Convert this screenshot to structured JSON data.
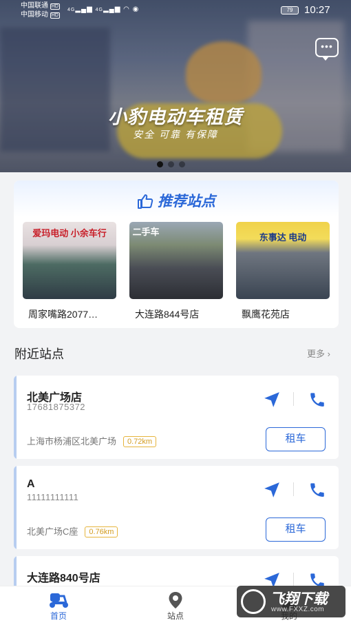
{
  "status_bar": {
    "carrier1": "中国联通",
    "carrier1_badge": "HD",
    "carrier2": "中国移动",
    "carrier2_badge": "HD",
    "network": "4G",
    "battery": "79",
    "time": "10:27"
  },
  "banner": {
    "title": "小豹电动车租赁",
    "subtitle": "安全 可靠 有保障",
    "slide_count": 3,
    "active_slide": 1,
    "chat_icon": "chat-bubble-icon"
  },
  "recommended": {
    "title": "推荐站点",
    "icon": "thumbs-up-icon",
    "stores": [
      {
        "name": "周家嘴路2077…",
        "sign_text": "爱玛电动 小余车行"
      },
      {
        "name": "大连路844号店",
        "sign_text": "二手车"
      },
      {
        "name": "飘鹰花苑店",
        "sign_text": "东事达 电动"
      }
    ]
  },
  "nearby": {
    "title": "附近站点",
    "more_label": "更多",
    "rent_label": "租车",
    "sites": [
      {
        "name": "北美广场店",
        "phone": "17681875372",
        "address": "上海市杨浦区北美广场",
        "distance": "0.72km"
      },
      {
        "name": "A",
        "phone": "11111111111",
        "address": "北美广场C座",
        "distance": "0.76km"
      },
      {
        "name": "大连路840号店",
        "phone": "",
        "address": "",
        "distance": ""
      }
    ]
  },
  "tabbar": {
    "tabs": [
      {
        "label": "首页",
        "icon": "scooter-icon",
        "active": true
      },
      {
        "label": "站点",
        "icon": "location-pin-icon",
        "active": false
      },
      {
        "label": "我的",
        "icon": "user-icon",
        "active": false
      }
    ]
  },
  "watermark": {
    "text": "飞翔下载",
    "url": "www.FXXZ.com"
  },
  "colors": {
    "accent": "#2b68d8",
    "distance_border": "#e6b43b",
    "bar": "#b7cdf0"
  }
}
